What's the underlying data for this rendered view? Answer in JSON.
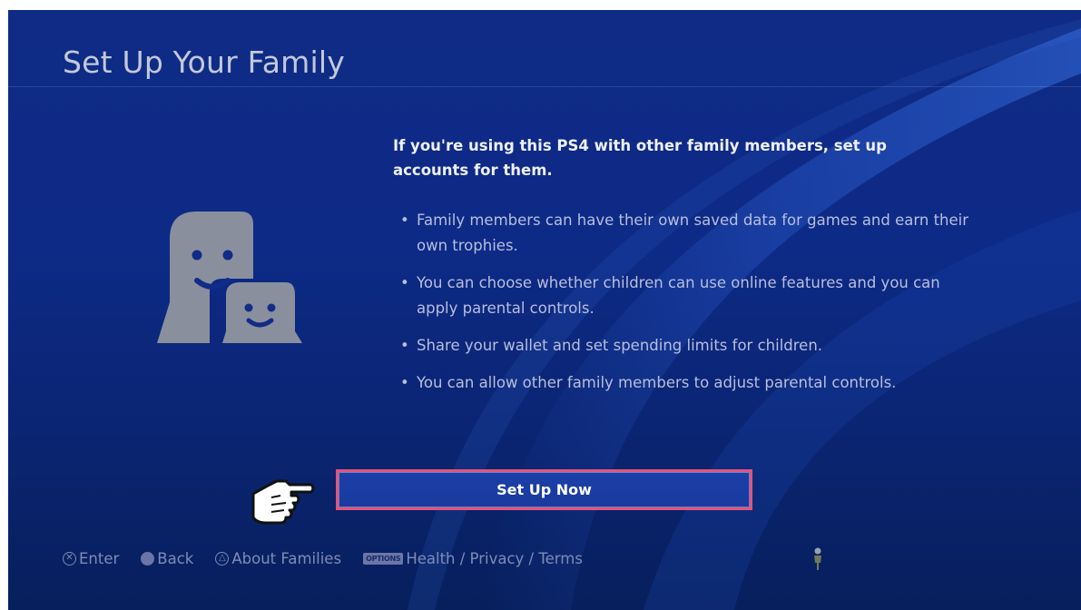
{
  "page": {
    "title": "Set Up Your Family",
    "headline": "If you're using this PS4 with other family members, set up accounts for them.",
    "bullets": [
      "Family members can have their own saved data for games and earn their own trophies.",
      "You can choose whether children can use online features and you can apply parental controls.",
      "Share your wallet and set spending limits for children.",
      "You can allow other family members to adjust parental controls."
    ],
    "bullet_glyph": "•",
    "primary_button": "Set Up Now",
    "family_icon": "family-icon",
    "pointer_icon": "hand-pointer-icon"
  },
  "footer": {
    "enter": {
      "glyph": "✕",
      "label": "Enter",
      "icon": "cross-button-icon"
    },
    "back": {
      "glyph": "○",
      "label": "Back",
      "icon": "circle-button-icon"
    },
    "about": {
      "glyph": "△",
      "label": "About Families",
      "icon": "triangle-button-icon"
    },
    "options": {
      "badge": "OPTIONS",
      "label": "Health / Privacy / Terms",
      "icon": "options-button-icon"
    },
    "user_icon": "user-avatar-icon"
  },
  "colors": {
    "background": "#0d2a86",
    "button_fill": "#1b3fa8",
    "focus_border": "#e2547c",
    "title_text": "#c3c8da",
    "body_text": "#b7bfdd",
    "footer_text": "#7f8bb8",
    "icon_gray": "#8a8f9e"
  }
}
